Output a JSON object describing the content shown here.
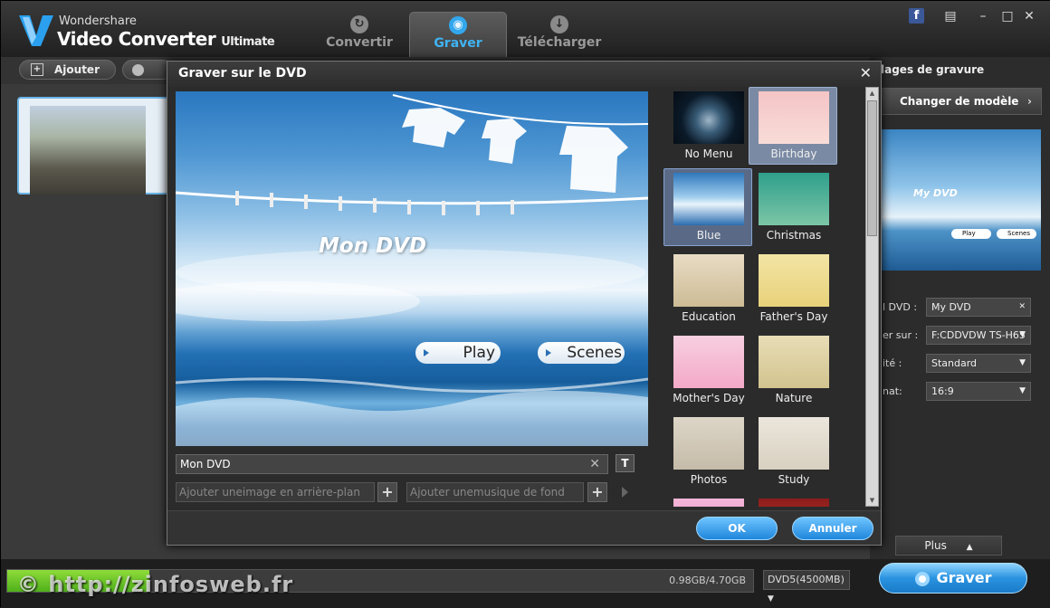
{
  "app": {
    "brand_small": "Wondershare",
    "brand_name": "Video Converter",
    "brand_edition": "Ultimate"
  },
  "tabs": [
    {
      "label": "Convertir",
      "icon": "refresh-icon",
      "active": false
    },
    {
      "label": "Graver",
      "icon": "disc-icon",
      "active": true
    },
    {
      "label": "Télécharger",
      "icon": "download-icon",
      "active": false
    }
  ],
  "toolbar": {
    "add_label": "Ajouter"
  },
  "settings": {
    "title": "lages de gravure",
    "change_template": "Changer de modèle",
    "preview_title": "My DVD",
    "preview_play": "Play",
    "preview_scenes": "Scenes",
    "fields": [
      {
        "label": "l DVD :",
        "value": "My DVD"
      },
      {
        "label": "er sur :",
        "value": "F:CDDVDW TS-H65"
      },
      {
        "label": "ité :",
        "value": "Standard"
      },
      {
        "label": "nat:",
        "value": "16:9"
      }
    ],
    "more": "Plus"
  },
  "bottom": {
    "size": "0.98GB/4.70GB",
    "progress_fraction": 0.19,
    "disc_type": "DVD5(4500MB)",
    "burn_label": "Graver",
    "watermark": "© http://zinfosweb.fr"
  },
  "dialog": {
    "title": "Graver sur le DVD",
    "preview_title": "Mon DVD",
    "play_label": "Play",
    "scenes_label": "Scenes",
    "title_value": "Mon DVD",
    "bg_image_placeholder": "Ajouter uneimage en arrière-plan",
    "bg_music_placeholder": "Ajouter unemusique de fond",
    "ok": "OK",
    "cancel": "Annuler",
    "templates": [
      {
        "label": "No Menu"
      },
      {
        "label": "Birthday"
      },
      {
        "label": "Blue"
      },
      {
        "label": "Christmas"
      },
      {
        "label": "Education"
      },
      {
        "label": "Father's Day"
      },
      {
        "label": "Mother's Day"
      },
      {
        "label": "Nature"
      },
      {
        "label": "Photos"
      },
      {
        "label": "Study"
      }
    ]
  },
  "colors": {
    "accent": "#32a7ee",
    "progress": "#6cc62a",
    "background": "#262626"
  }
}
